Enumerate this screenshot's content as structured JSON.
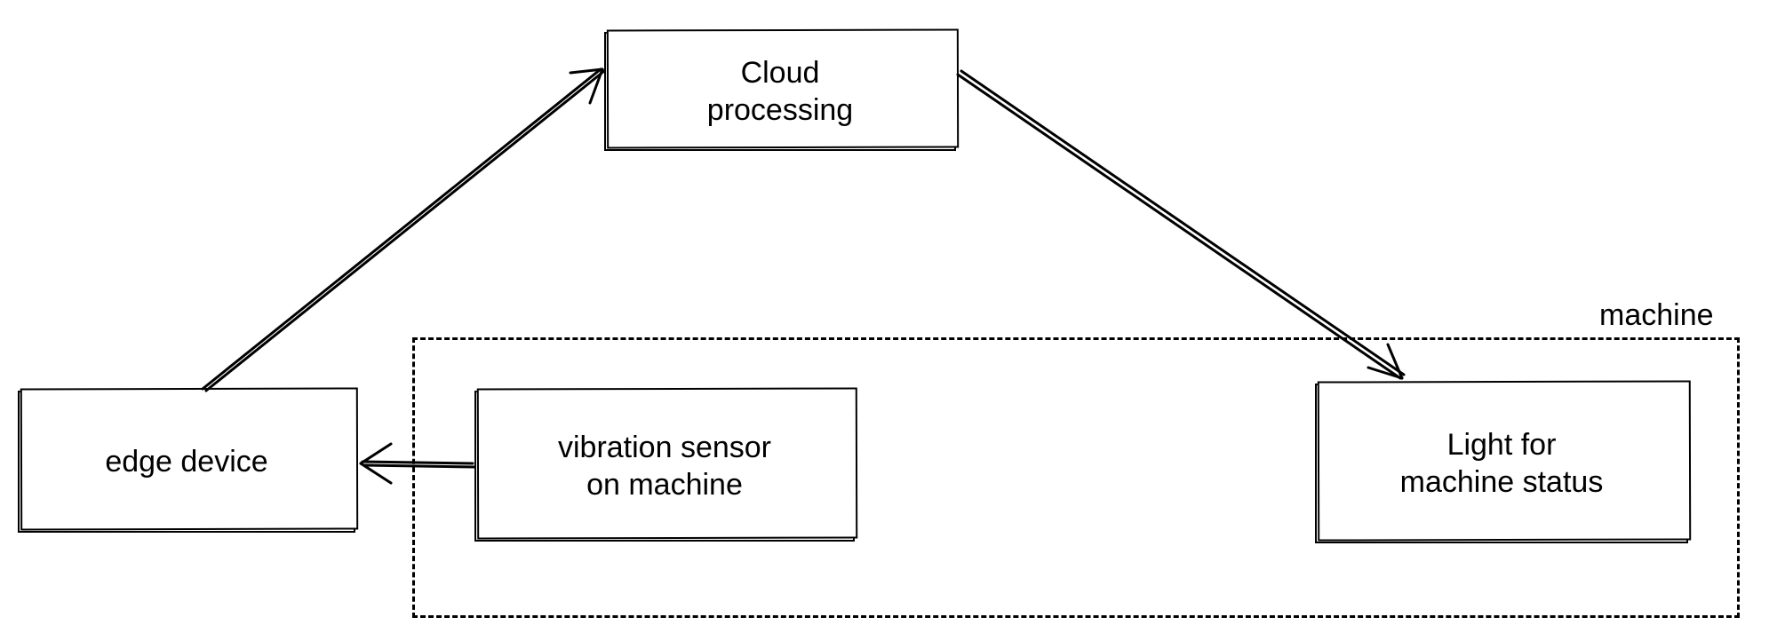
{
  "nodes": {
    "cloud": {
      "label": "Cloud\nprocessing"
    },
    "edge": {
      "label": "edge device"
    },
    "sensor": {
      "label": "vibration sensor\non machine"
    },
    "light": {
      "label": "Light for\nmachine status"
    }
  },
  "group": {
    "machine": {
      "label": "machine"
    }
  },
  "edges": [
    {
      "from": "sensor",
      "to": "edge",
      "kind": "arrow"
    },
    {
      "from": "edge",
      "to": "cloud",
      "kind": "arrow"
    },
    {
      "from": "cloud",
      "to": "light",
      "kind": "arrow"
    }
  ]
}
